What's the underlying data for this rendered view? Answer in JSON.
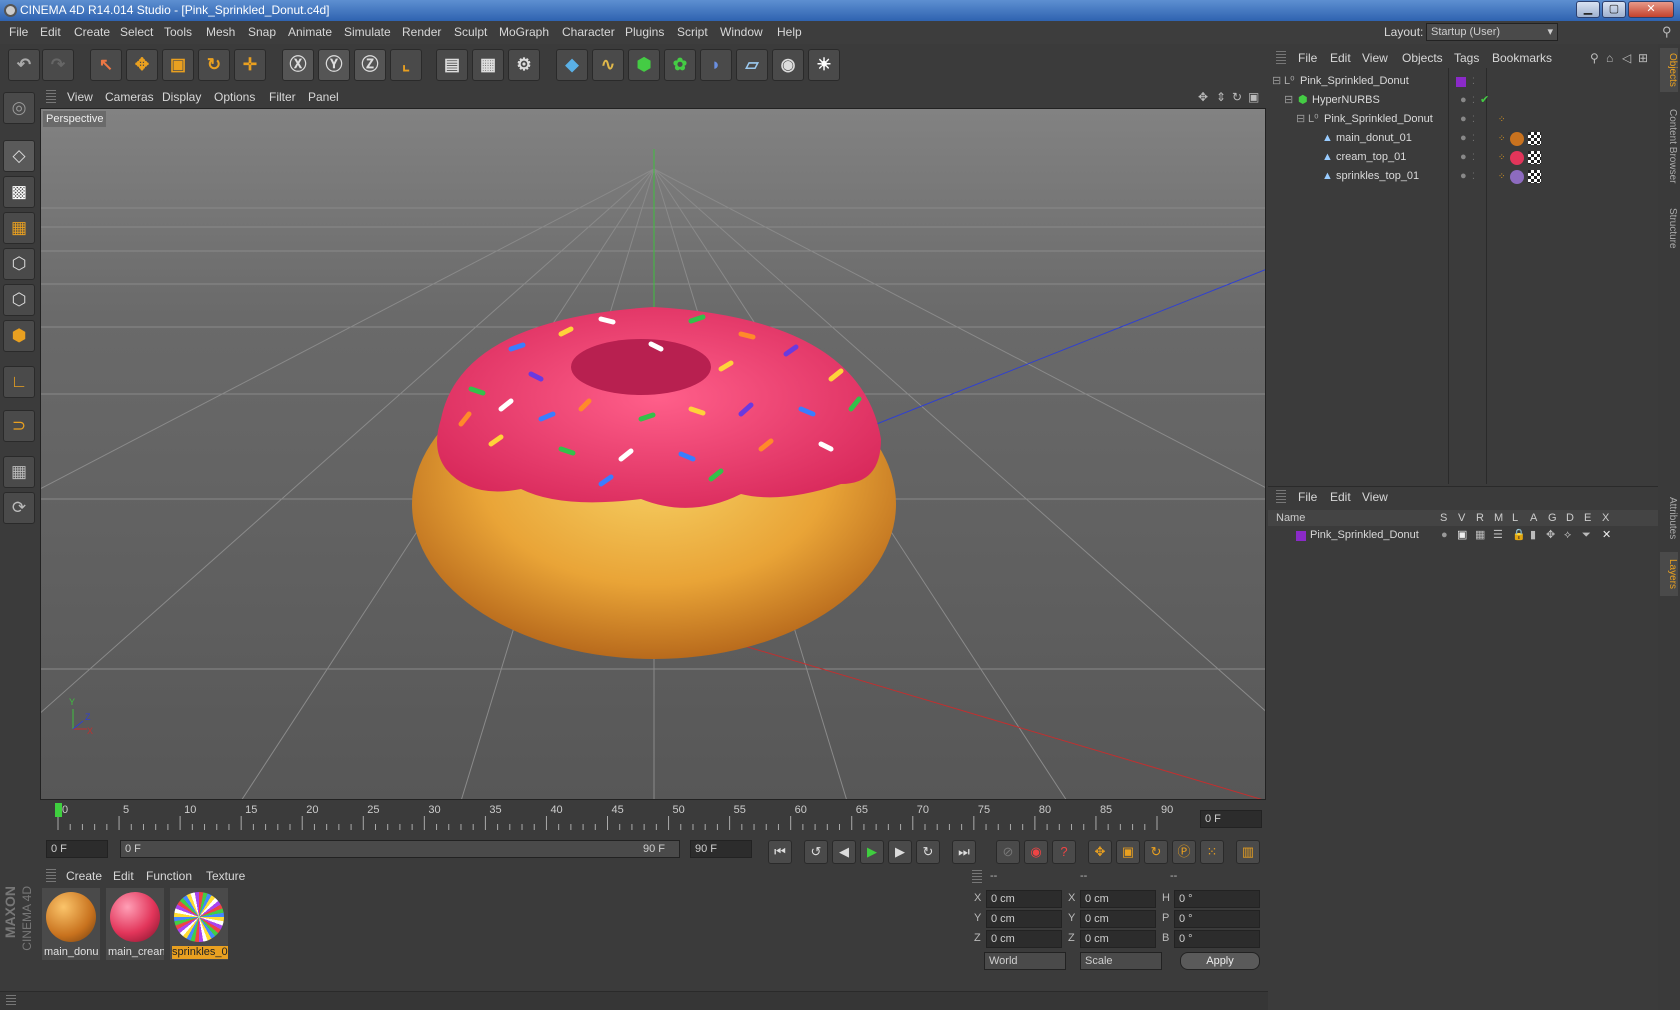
{
  "window": {
    "title": "CINEMA 4D R14.014 Studio - [Pink_Sprinkled_Donut.c4d]",
    "min": "▁",
    "max": "▢",
    "close": "✕"
  },
  "menu": [
    "File",
    "Edit",
    "Create",
    "Select",
    "Tools",
    "Mesh",
    "Snap",
    "Animate",
    "Simulate",
    "Render",
    "Sculpt",
    "MoGraph",
    "Character",
    "Plugins",
    "Script",
    "Window",
    "Help"
  ],
  "layout": {
    "label": "Layout:",
    "value": "Startup (User)"
  },
  "viewport": {
    "menu": [
      "View",
      "Cameras",
      "Display",
      "Options",
      "Filter",
      "Panel"
    ],
    "label": "Perspective"
  },
  "timeline": {
    "ticks": [
      "0",
      "5",
      "10",
      "15",
      "20",
      "25",
      "30",
      "35",
      "40",
      "45",
      "50",
      "55",
      "60",
      "65",
      "70",
      "75",
      "80",
      "85",
      "90"
    ],
    "current_frame": "0 F",
    "start_frame": "0 F",
    "range_start": "0 F",
    "range_end": "90 F",
    "end_frame": "90 F"
  },
  "materials": {
    "menu": [
      "Create",
      "Edit",
      "Function",
      "Texture"
    ],
    "items": [
      {
        "label": "main_donu",
        "color": "#c8721e"
      },
      {
        "label": "main_crean",
        "color": "#e2355a"
      },
      {
        "label": "sprinkles_0",
        "color": "#8d6bbf"
      }
    ]
  },
  "coords": {
    "headers": [
      "--",
      "--",
      "--"
    ],
    "rows": [
      {
        "a": "X",
        "av": "0 cm",
        "b": "X",
        "bv": "0 cm",
        "c": "H",
        "cv": "0 °"
      },
      {
        "a": "Y",
        "av": "0 cm",
        "b": "Y",
        "bv": "0 cm",
        "c": "P",
        "cv": "0 °"
      },
      {
        "a": "Z",
        "av": "0 cm",
        "b": "Z",
        "bv": "0 cm",
        "c": "B",
        "cv": "0 °"
      }
    ],
    "world": "World",
    "scale": "Scale",
    "apply": "Apply"
  },
  "objects": {
    "menu": [
      "File",
      "Edit",
      "View",
      "Objects",
      "Tags",
      "Bookmarks"
    ],
    "tree": [
      {
        "name": "Pink_Sprinkled_Donut",
        "indent": 0
      },
      {
        "name": "HyperNURBS",
        "indent": 1
      },
      {
        "name": "Pink_Sprinkled_Donut",
        "indent": 2
      },
      {
        "name": "main_donut_01",
        "indent": 3
      },
      {
        "name": "cream_top_01",
        "indent": 3
      },
      {
        "name": "sprinkles_top_01",
        "indent": 3
      }
    ]
  },
  "layers": {
    "menu": [
      "File",
      "Edit",
      "View"
    ],
    "columns": [
      "Name",
      "S",
      "V",
      "R",
      "M",
      "L",
      "A",
      "G",
      "D",
      "E",
      "X"
    ],
    "row": "Pink_Sprinkled_Donut"
  },
  "sidetabs": [
    "Objects",
    "Content Browser",
    "Structure",
    "Attributes",
    "Layers"
  ],
  "brand": {
    "top": "MAXON",
    "bottom": "CINEMA 4D"
  }
}
